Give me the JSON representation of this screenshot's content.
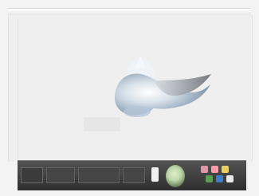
{
  "window": {
    "title": ""
  },
  "canvas": {
    "image_icon": "bird-image"
  },
  "taskbar": {
    "start_label": "",
    "buttons": [
      {
        "label": ""
      },
      {
        "label": ""
      },
      {
        "label": ""
      }
    ],
    "icons": [
      {
        "name": "light-icon"
      },
      {
        "name": "green-app-icon"
      }
    ],
    "tray_colors": [
      "#d89aa6",
      "#ff9aa8",
      "#e7d06b",
      "#5d9f52",
      "#3f7ec7",
      "#e8e8e8"
    ]
  }
}
